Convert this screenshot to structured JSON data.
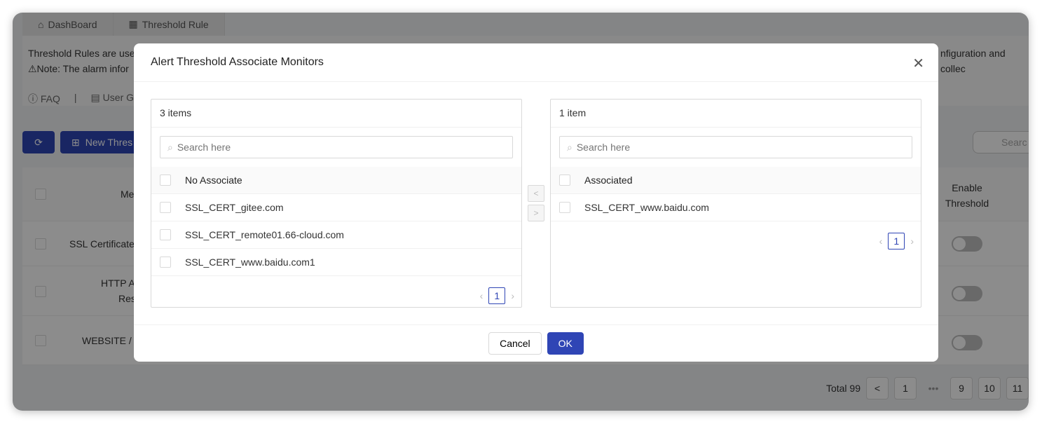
{
  "tabs": [
    {
      "label": "DashBoard",
      "icon": "home-icon"
    },
    {
      "label": "Threshold Rule",
      "icon": "calculator-icon"
    }
  ],
  "info": {
    "line1_left": "Threshold Rules are use",
    "line1_right": "nfiguration and collec",
    "line2": "⚠Note: The alarm infor"
  },
  "links": {
    "faq": "FAQ",
    "sep": "|",
    "guide": "User G"
  },
  "toolbar": {
    "new_label": "New Thres",
    "search_placeholder": "Searc"
  },
  "table": {
    "header_metric": "Me",
    "header_enable": [
      "Enable",
      "Threshold"
    ],
    "rows": [
      {
        "name": "SSL Certificate",
        "enabled": false
      },
      {
        "name": "HTTP A",
        "name2": "Res",
        "enabled": false
      },
      {
        "name": "WEBSITE / s",
        "enabled": false
      }
    ]
  },
  "pagination": {
    "total": "Total 99",
    "pages": [
      "1",
      "•••",
      "9",
      "10",
      "11"
    ]
  },
  "modal": {
    "title": "Alert Threshold Associate Monitors",
    "left": {
      "count": "3 items",
      "placeholder": "Search here",
      "header": "No Associate",
      "items": [
        "SSL_CERT_gitee.com",
        "SSL_CERT_remote01.66-cloud.com",
        "SSL_CERT_www.baidu.com1"
      ],
      "page": "1"
    },
    "right": {
      "count": "1 item",
      "placeholder": "Search here",
      "header": "Associated",
      "items": [
        "SSL_CERT_www.baidu.com"
      ],
      "page": "1"
    },
    "cancel": "Cancel",
    "ok": "OK"
  },
  "colors": {
    "primary": "#2f45b5"
  }
}
